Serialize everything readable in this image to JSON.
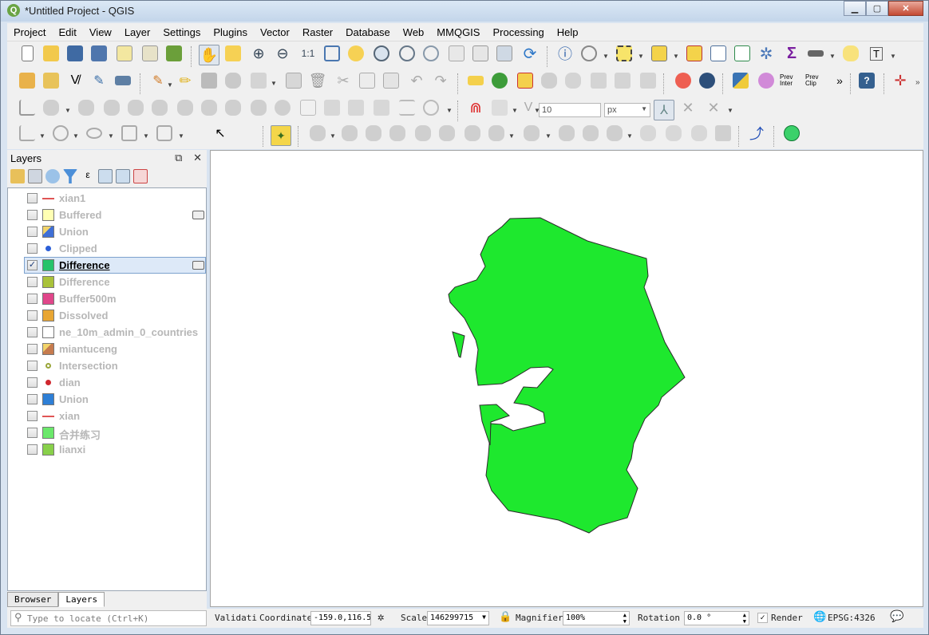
{
  "window": {
    "title": "*Untitled Project - QGIS",
    "app_icon": "Q"
  },
  "menu": [
    "Project",
    "Edit",
    "View",
    "Layer",
    "Settings",
    "Plugins",
    "Vector",
    "Raster",
    "Database",
    "Web",
    "MMQGIS",
    "Processing",
    "Help"
  ],
  "toolbar": {
    "snap_tolerance": "10",
    "snap_units": "px",
    "prev_inter": "Prev Inter",
    "prev_clip": "Prev Clip",
    "more": "»"
  },
  "layers_panel": {
    "title": "Layers",
    "restore_icon": "⧉",
    "close_icon": "✕",
    "layers": [
      {
        "name": "xian1",
        "checked": false,
        "symbol": "line",
        "color": "#e05555"
      },
      {
        "name": "Buffered",
        "checked": false,
        "symbol": "fill",
        "color": "#ffffb3",
        "editing": true
      },
      {
        "name": "Union",
        "checked": false,
        "symbol": "raster",
        "color": "#3f6fd6"
      },
      {
        "name": "Clipped",
        "checked": false,
        "symbol": "point",
        "color": "#2c5fd8"
      },
      {
        "name": "Difference",
        "checked": true,
        "symbol": "fill",
        "color": "#25c36a",
        "editing": true,
        "selected": true
      },
      {
        "name": "Difference",
        "checked": false,
        "symbol": "fill",
        "color": "#a9c23a"
      },
      {
        "name": "Buffer500m",
        "checked": false,
        "symbol": "fill",
        "color": "#e0468a"
      },
      {
        "name": "Dissolved",
        "checked": false,
        "symbol": "fill",
        "color": "#e8a634"
      },
      {
        "name": "ne_10m_admin_0_countries",
        "checked": false,
        "symbol": "fill",
        "color": "#ffffff"
      },
      {
        "name": "miantuceng",
        "checked": false,
        "symbol": "raster",
        "color": "#c67b4e"
      },
      {
        "name": "Intersection",
        "checked": false,
        "symbol": "point-hollow",
        "color": "#9aa63a"
      },
      {
        "name": "dian",
        "checked": false,
        "symbol": "point",
        "color": "#d0272e"
      },
      {
        "name": "Union",
        "checked": false,
        "symbol": "fill",
        "color": "#2e7fd6"
      },
      {
        "name": "xian",
        "checked": false,
        "symbol": "line",
        "color": "#e05555"
      },
      {
        "name": "合并练习",
        "checked": false,
        "symbol": "fill",
        "color": "#6be86b"
      },
      {
        "name": "lianxi",
        "checked": false,
        "symbol": "fill",
        "color": "#88d04a"
      }
    ],
    "tabs": [
      "Browser",
      "Layers"
    ]
  },
  "map": {
    "polygon_fill": "#1ee82e",
    "polygon_stroke": "#2a2a2a"
  },
  "statusbar": {
    "locate_placeholder": "Type to locate (Ctrl+K)",
    "validating": "Validati",
    "coordinate_label": "Coordinate",
    "coordinate_value": "-159.0,116.5",
    "scale_label": "Scale",
    "scale_value": "146299715",
    "magnifier_label": "Magnifier",
    "magnifier_value": "100%",
    "rotation_label": "Rotation",
    "rotation_value": "0.0 °",
    "render_label": "Render",
    "render_checked": true,
    "crs": "EPSG:4326"
  }
}
